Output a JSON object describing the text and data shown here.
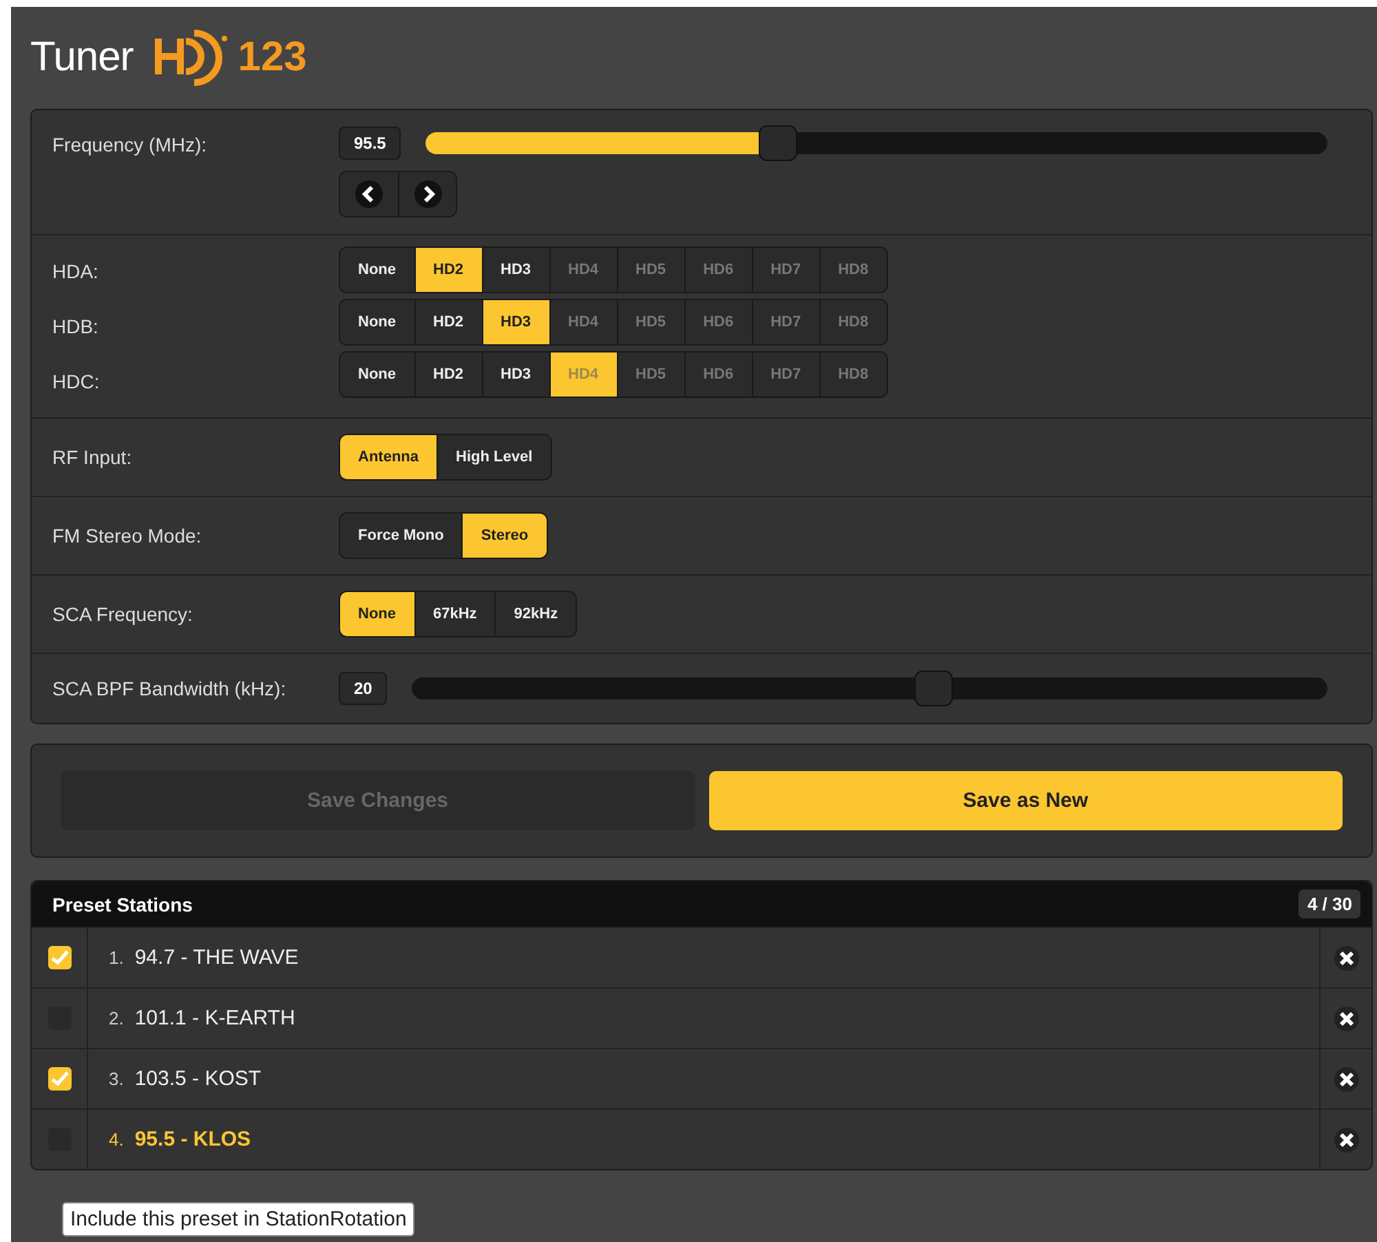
{
  "title": {
    "text": "Tuner",
    "logo_number": "123"
  },
  "frequency": {
    "label": "Frequency (MHz):",
    "value": "95.5",
    "level": 0.39,
    "filled": true
  },
  "hd_rows": [
    {
      "label": "HDA:",
      "options": [
        {
          "label": "None",
          "selected": false,
          "disabled": false
        },
        {
          "label": "HD2",
          "selected": true,
          "disabled": false
        },
        {
          "label": "HD3",
          "selected": false,
          "disabled": false
        },
        {
          "label": "HD4",
          "selected": false,
          "disabled": true
        },
        {
          "label": "HD5",
          "selected": false,
          "disabled": true
        },
        {
          "label": "HD6",
          "selected": false,
          "disabled": true
        },
        {
          "label": "HD7",
          "selected": false,
          "disabled": true
        },
        {
          "label": "HD8",
          "selected": false,
          "disabled": true
        }
      ]
    },
    {
      "label": "HDB:",
      "options": [
        {
          "label": "None",
          "selected": false,
          "disabled": false
        },
        {
          "label": "HD2",
          "selected": false,
          "disabled": false
        },
        {
          "label": "HD3",
          "selected": true,
          "disabled": false
        },
        {
          "label": "HD4",
          "selected": false,
          "disabled": true
        },
        {
          "label": "HD5",
          "selected": false,
          "disabled": true
        },
        {
          "label": "HD6",
          "selected": false,
          "disabled": true
        },
        {
          "label": "HD7",
          "selected": false,
          "disabled": true
        },
        {
          "label": "HD8",
          "selected": false,
          "disabled": true
        }
      ]
    },
    {
      "label": "HDC:",
      "options": [
        {
          "label": "None",
          "selected": false,
          "disabled": false
        },
        {
          "label": "HD2",
          "selected": false,
          "disabled": false
        },
        {
          "label": "HD3",
          "selected": false,
          "disabled": false
        },
        {
          "label": "HD4",
          "selected": true,
          "disabled": true
        },
        {
          "label": "HD5",
          "selected": false,
          "disabled": true
        },
        {
          "label": "HD6",
          "selected": false,
          "disabled": true
        },
        {
          "label": "HD7",
          "selected": false,
          "disabled": true
        },
        {
          "label": "HD8",
          "selected": false,
          "disabled": true
        }
      ]
    }
  ],
  "settings": [
    {
      "label": "RF Input:",
      "options": [
        {
          "label": "Antenna",
          "selected": true
        },
        {
          "label": "High Level",
          "selected": false
        }
      ]
    },
    {
      "label": "FM Stereo Mode:",
      "options": [
        {
          "label": "Force Mono",
          "selected": false
        },
        {
          "label": "Stereo",
          "selected": true
        }
      ]
    },
    {
      "label": "SCA Frequency:",
      "options": [
        {
          "label": "None",
          "selected": true
        },
        {
          "label": "67kHz",
          "selected": false
        },
        {
          "label": "92kHz",
          "selected": false
        }
      ]
    }
  ],
  "bandwidth": {
    "label": "SCA BPF Bandwidth (kHz):",
    "value": "20",
    "level": 0.57,
    "filled": false
  },
  "buttons": [
    {
      "label": "Save Changes",
      "disabled": true
    },
    {
      "label": "Save as New",
      "disabled": false
    }
  ],
  "presets": {
    "title": "Preset Stations",
    "count": "4 / 30",
    "items": [
      {
        "number": "1.",
        "name": "94.7 - THE WAVE",
        "checked": true,
        "current": false
      },
      {
        "number": "2.",
        "name": "101.1 - K-EARTH",
        "checked": false,
        "current": false
      },
      {
        "number": "3.",
        "name": "103.5 - KOST",
        "checked": true,
        "current": false
      },
      {
        "number": "4.",
        "name": "95.5 - KLOS",
        "checked": false,
        "current": true
      }
    ]
  },
  "tooltip": "Include this preset in StationRotation"
}
